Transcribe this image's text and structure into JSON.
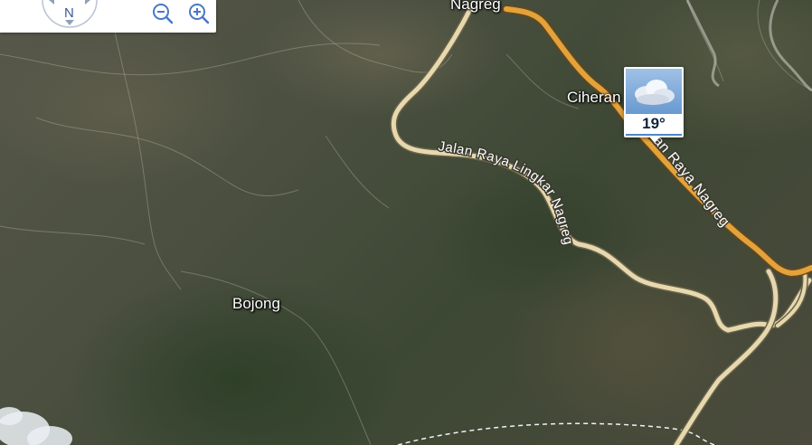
{
  "map": {
    "labels": {
      "nagreg": "Nagreg",
      "ciheran": "Ciheran",
      "bojong": "Bojong",
      "lingkar_road": "Jalan Raya Lingkar Nagreg",
      "nagreg_road": "an Raya Nagreg"
    },
    "colors": {
      "main_road": "#e2a33c",
      "main_road_edge": "#8a5a1a",
      "minor_road": "#e6d9b0",
      "boundary": "#f2f2f2"
    }
  },
  "nav": {
    "compass_label": "N",
    "zoom_out_icon": "zoom-out-icon",
    "zoom_in_icon": "zoom-in-icon"
  },
  "weather": {
    "temperature": "19°",
    "icon": "cloud-icon"
  }
}
